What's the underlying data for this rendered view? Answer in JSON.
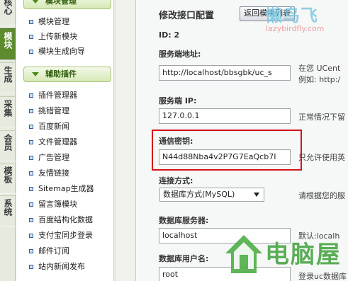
{
  "side_tabs": [
    {
      "label": "核心",
      "active": false
    },
    {
      "label": "模块",
      "active": true
    },
    {
      "label": "生成",
      "active": false
    },
    {
      "label": "采集",
      "active": false
    },
    {
      "label": "会员",
      "active": false
    },
    {
      "label": "模板",
      "active": false
    },
    {
      "label": "系统",
      "active": false
    }
  ],
  "menu": {
    "module_section": {
      "title": "模块管理",
      "items": [
        "模块管理",
        "上传新模块",
        "模块生成向导"
      ]
    },
    "plugin_section": {
      "title": "辅助插件",
      "items": [
        "插件管理器",
        "挑错管理",
        "百度新闻",
        "文件管理器",
        "广告管理",
        "友情链接",
        "Sitemap生成器",
        "留言簿模块",
        "百度结构化数据",
        "支付宝同步登录",
        "邮件订阅",
        "站内新闻发布"
      ]
    }
  },
  "form": {
    "title": "修改接口配置",
    "back_button": "返回模块列表",
    "id_line": "ID: 2",
    "server_url": {
      "label": "服务端地址:",
      "value": "http://localhost/bbsgbk/uc_s",
      "hint": "在您 UCent",
      "hint2": "例如: http:/"
    },
    "server_ip": {
      "label": "服务端 IP:",
      "value": "127.0.0.1",
      "hint": "正常情况下留"
    },
    "comm_key": {
      "label": "通信密钥:",
      "value": "N44d88Nba4v2P7G7EaQcb7I",
      "hint": "只允许使用英"
    },
    "connect_method": {
      "label": "连接方式:",
      "value": "数据库方式(MySQL)",
      "hint": "请根据您的服"
    },
    "db_server": {
      "label": "数据库服务器:",
      "value": "localhost",
      "hint": "默认:localh"
    },
    "db_user": {
      "label": "数据库用户名:",
      "value": "root",
      "hint": "登录uc数据库"
    }
  },
  "watermarks": {
    "top_text": "懒鸟飞",
    "top_url": "lazybirdfly.com",
    "bottom_text": "电脑屋"
  }
}
